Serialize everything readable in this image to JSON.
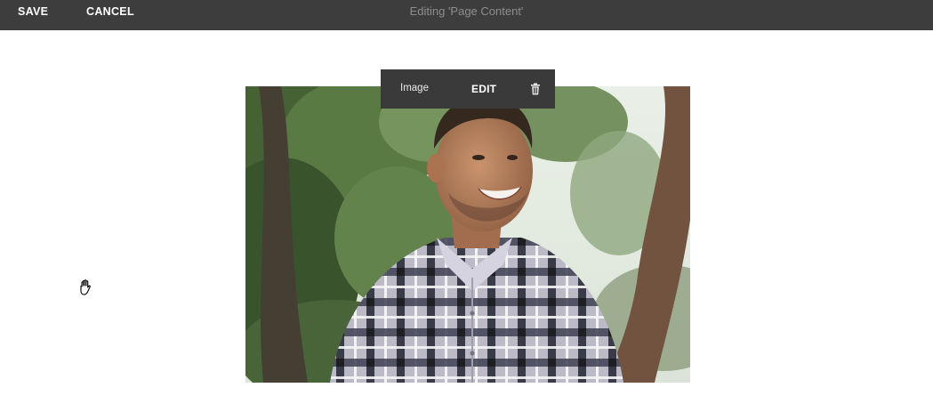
{
  "header": {
    "save_label": "SAVE",
    "cancel_label": "CANCEL",
    "title": "Editing 'Page Content'"
  },
  "image_block": {
    "type_label": "Image",
    "edit_label": "EDIT",
    "delete_icon": "trash-icon"
  },
  "cursor": {
    "icon": "hand-grab-cursor-icon"
  },
  "colors": {
    "topbar_bg": "#3d3d3d",
    "toolbar_bg": "#3a3a3a",
    "title_text": "#8e8e8e",
    "page_bg": "#ffffff"
  }
}
